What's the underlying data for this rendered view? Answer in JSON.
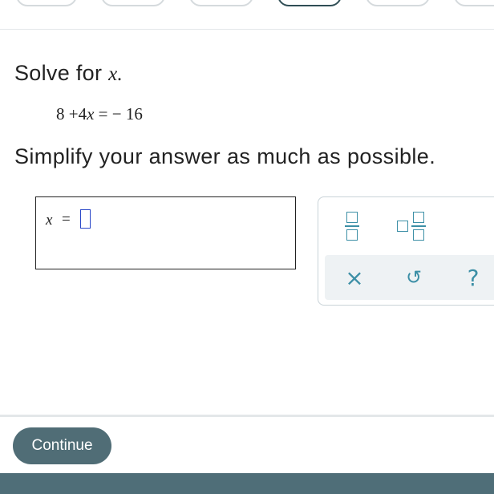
{
  "question": {
    "prompt_prefix": "Solve for",
    "prompt_var": "x.",
    "equation": {
      "lhs_const": "8",
      "plus": "+",
      "coef": "4",
      "var": "x",
      "eq": "=",
      "rhs": "− 16"
    },
    "instruction": "Simplify your answer as much as possible."
  },
  "answer": {
    "var": "x",
    "eq": "="
  },
  "palette": {
    "fraction_icon": "fraction-icon",
    "mixed_number_icon": "mixed-number-icon",
    "clear": "×",
    "undo": "↺",
    "help": "?"
  },
  "footer": {
    "continue_label": "Continue"
  }
}
